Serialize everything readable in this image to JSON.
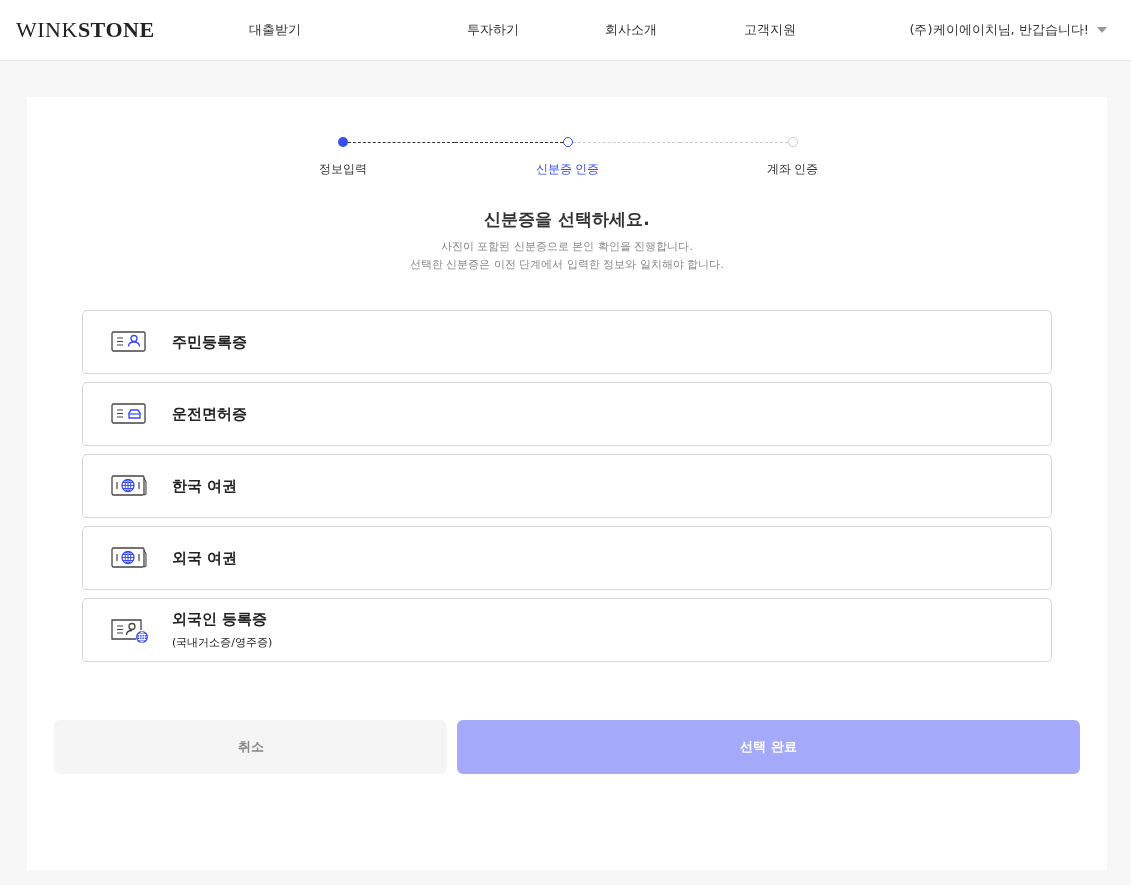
{
  "header": {
    "logo": "WINK**STONE**",
    "nav": [
      "대출받기",
      "투자하기",
      "회사소개",
      "고객지원"
    ],
    "user_menu": "(주)케이에이치님, 반갑습니다!"
  },
  "steps": [
    {
      "label": "정보입력",
      "completed": true,
      "selected": false
    },
    {
      "label": "신분증 인증",
      "completed": false,
      "selected": true
    },
    {
      "label": "계좌 인증",
      "completed": false,
      "selected": false
    }
  ],
  "title": "신분증을 선택하세요.",
  "description": [
    "사진이 포함된 신분증으로 본인 확인을 진행합니다.",
    "선택한 신분증은 이전 단계에서 입력한 정보와 일치해야 합니다."
  ],
  "options": [
    {
      "kind": "resident",
      "label": "주민등록증",
      "selected": false
    },
    {
      "kind": "license",
      "label": "운전면허증",
      "selected": false
    },
    {
      "kind": "passport",
      "label": "한국 여권",
      "selected": false
    },
    {
      "kind": "passport",
      "label": "외국 여권",
      "selected": false
    },
    {
      "kind": "foreigner",
      "label": "외국인 등록증",
      "sublabel": "(국내거소증/영주증)",
      "selected": false
    }
  ],
  "buttons": {
    "cancel": "취소",
    "submit": "선택 완료",
    "submit_disabled": true
  }
}
